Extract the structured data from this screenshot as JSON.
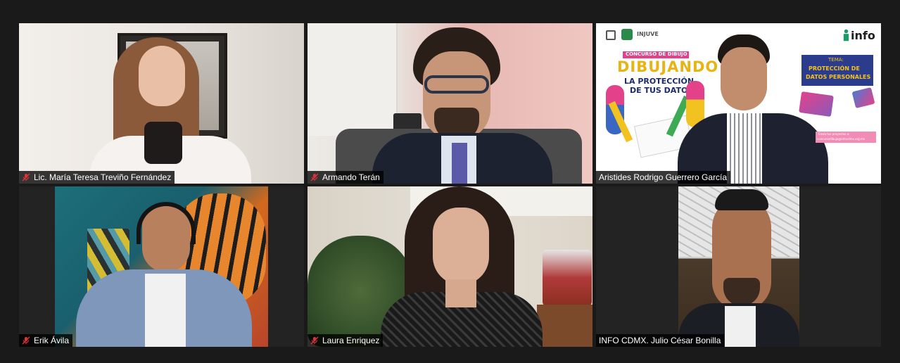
{
  "participants": [
    {
      "name": "Lic. María Teresa Treviño Fernández"
    },
    {
      "name": "Armando Terán"
    },
    {
      "name": "Aristides Rodrigo Guerrero García"
    },
    {
      "name": "Erik Ávila"
    },
    {
      "name": "Laura Enriquez"
    },
    {
      "name": "INFO CDMX. Julio César Bonilla"
    }
  ],
  "banner": {
    "injuve": "INJUVE",
    "info_logo": "info",
    "concurso": "CONCURSO DE DIBUJO",
    "title_line1": "DIBUJANDO",
    "title_line2": "LA PROTECCIÓN",
    "title_line3": "DE TUS DATOS",
    "tema_label": "TEMA:",
    "tema_line1": "PROTECCIÓN DE",
    "tema_line2": "DATOS PERSONALES",
    "pink_line1": "Envía tus proyectos a:",
    "pink_line2": "concursodibujo@infocdmx.org.mx"
  },
  "colors": {
    "mute": "#e0303a",
    "background": "#1a1a1a",
    "tile": "#232323",
    "label_bg": "#000000"
  }
}
